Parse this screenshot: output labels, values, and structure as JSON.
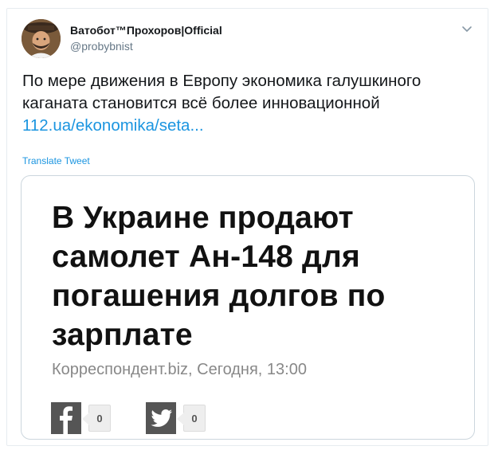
{
  "author": {
    "display_name": "Ватобот™Прохоров|Official",
    "handle": "@probybnist"
  },
  "tweet": {
    "text_lines": [
      "По мере движения в Европу экономика галушкиного",
      "каганата становится всё более инновационной"
    ],
    "link_text": "112.ua/ekonomika/seta...",
    "translate_label": "Translate Tweet"
  },
  "card": {
    "headline_lines": [
      "В Украине продают",
      "самолет Ан-148 для",
      "погашения долгов по",
      "зарплате"
    ],
    "source_line": "Корреспондент.biz, Сегодня, 13:00",
    "share": {
      "facebook_count": "0",
      "twitter_count": "0"
    }
  },
  "icons": {
    "menu": "chevron-down-icon",
    "facebook": "facebook-icon",
    "twitter": "twitter-bird-icon"
  },
  "colors": {
    "link": "#1b95e0",
    "handle": "#657786",
    "share_icon_bg": "#555555"
  }
}
